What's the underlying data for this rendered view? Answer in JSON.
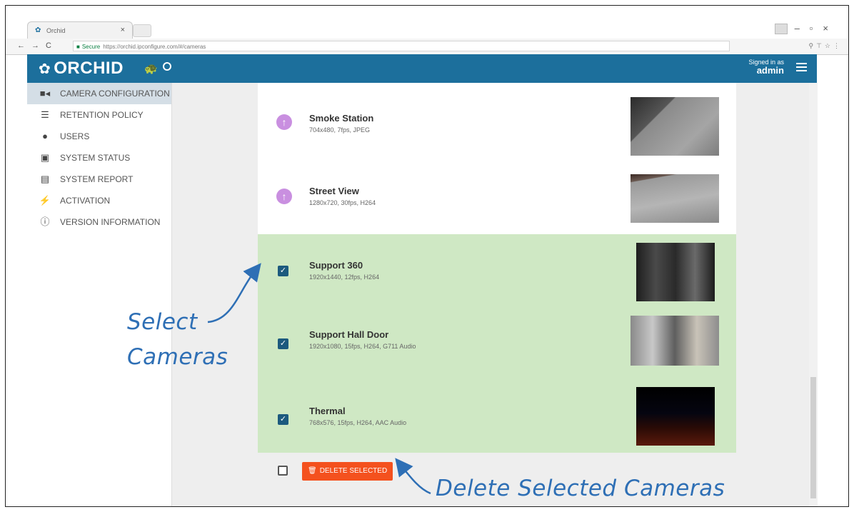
{
  "browser": {
    "tab_title": "Orchid",
    "url_secure": "Secure",
    "url": "https://orchid.ipconfigure.com/#/cameras"
  },
  "header": {
    "logo": "ORCHID",
    "signed_in_label": "Signed in as",
    "user": "admin"
  },
  "sidebar": {
    "items": [
      {
        "label": "CAMERA CONFIGURATION",
        "icon": "video-camera-icon",
        "active": true
      },
      {
        "label": "RETENTION POLICY",
        "icon": "database-icon"
      },
      {
        "label": "USERS",
        "icon": "user-icon"
      },
      {
        "label": "SYSTEM STATUS",
        "icon": "medkit-icon"
      },
      {
        "label": "SYSTEM REPORT",
        "icon": "report-icon"
      },
      {
        "label": "ACTIVATION",
        "icon": "plug-icon"
      },
      {
        "label": "VERSION INFORMATION",
        "icon": "info-icon"
      }
    ]
  },
  "cameras": [
    {
      "name": "Smoke Station",
      "spec": "704x480, 7fps, JPEG",
      "selected": false
    },
    {
      "name": "Street View",
      "spec": "1280x720, 30fps, H264",
      "selected": false
    },
    {
      "name": "Support 360",
      "spec": "1920x1440, 12fps, H264",
      "selected": true
    },
    {
      "name": "Support Hall Door",
      "spec": "1920x1080, 15fps, H264, G711 Audio",
      "selected": true
    },
    {
      "name": "Thermal",
      "spec": "768x576, 15fps, H264, AAC Audio",
      "selected": true
    }
  ],
  "footer": {
    "delete_label": "DELETE SELECTED"
  },
  "annotations": {
    "select_line1": "Select",
    "select_line2": "Cameras",
    "delete": "Delete Selected Cameras"
  },
  "colors": {
    "header": "#1c6f9c",
    "selected_row": "#cfe8c4",
    "delete_button": "#f4511e",
    "annotation": "#2e6fb5"
  }
}
